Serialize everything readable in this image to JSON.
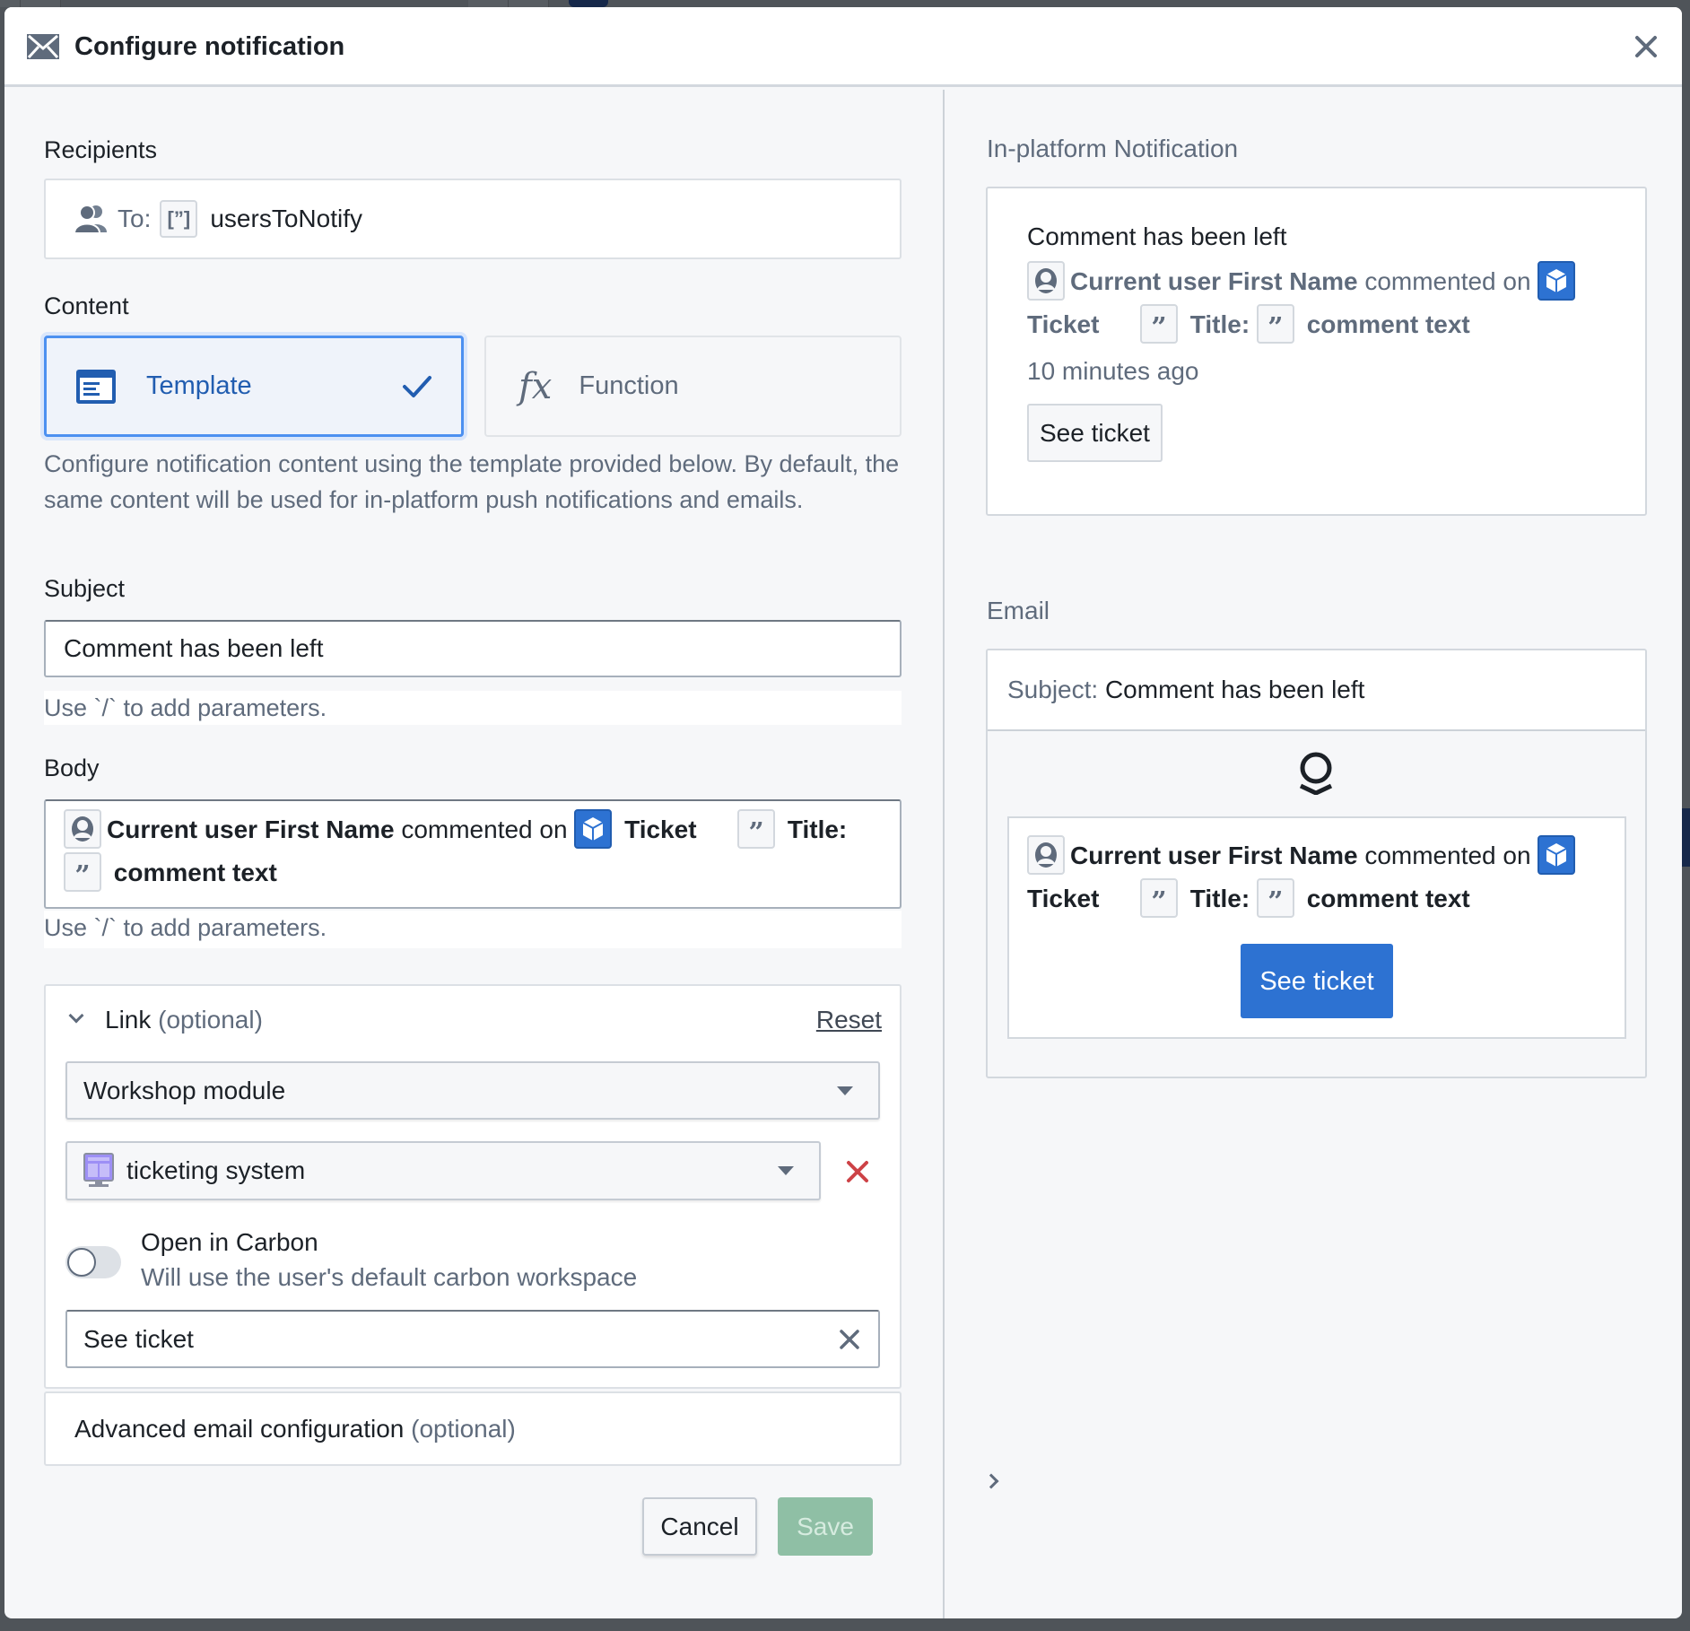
{
  "dialog": {
    "title": "Configure notification",
    "icon": "envelope-icon",
    "close_icon": "close-icon"
  },
  "recipients": {
    "label": "Recipients",
    "to_label": "To:",
    "value": "usersToNotify"
  },
  "content": {
    "label": "Content",
    "options": [
      {
        "label": "Template",
        "selected": true,
        "icon": "template-icon"
      },
      {
        "label": "Function",
        "selected": false,
        "icon": "fx-icon"
      }
    ],
    "description": "Configure notification content using the template provided below. By default, the same content will be used for in-platform push notifications and emails."
  },
  "subject": {
    "label": "Subject",
    "value": "Comment has been left",
    "hint": "Use `/` to add parameters."
  },
  "body": {
    "label": "Body",
    "hint": "Use `/` to add parameters.",
    "tokens": {
      "user": "Current user First Name",
      "commented_on": "commented on",
      "object": "Ticket",
      "title": "Title:",
      "comment": "comment text"
    }
  },
  "link": {
    "label": "Link",
    "optional": "(optional)",
    "reset": "Reset",
    "type_value": "Workshop module",
    "module_value": "ticketing system",
    "open_in_carbon": {
      "label": "Open in Carbon",
      "description": "Will use the user's default carbon workspace",
      "enabled": false
    },
    "button_text": "See ticket"
  },
  "advanced": {
    "label": "Advanced email configuration",
    "optional": "(optional)"
  },
  "footer": {
    "cancel": "Cancel",
    "save": "Save"
  },
  "preview": {
    "in_platform": {
      "label": "In-platform Notification",
      "subject": "Comment has been left",
      "time": "10 minutes ago",
      "button": "See ticket"
    },
    "email": {
      "label": "Email",
      "subject_label": "Subject:",
      "subject": "Comment has been left",
      "button": "See ticket"
    }
  },
  "colors": {
    "accent": "#2d72d2",
    "selected_border": "#4c90f0",
    "save_disabled": "#8fbfa5",
    "danger": "#cd4246",
    "muted_text": "#5f6b7c"
  }
}
